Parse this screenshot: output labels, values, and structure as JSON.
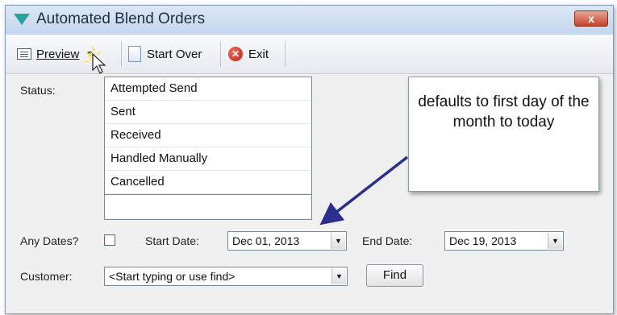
{
  "window": {
    "title": "Automated Blend Orders",
    "close_glyph": "x"
  },
  "toolbar": {
    "preview_label": "Preview",
    "start_over_label": "Start Over",
    "exit_label": "Exit",
    "icons": {
      "preview": "preview-icon",
      "start_over": "document-icon",
      "exit": "exit-icon"
    }
  },
  "form": {
    "status_label": "Status:",
    "status_options": [
      "Attempted Send",
      "Sent",
      "Received",
      "Handled Manually",
      "Cancelled"
    ],
    "any_dates_label": "Any Dates?",
    "any_dates_checked": false,
    "start_date_label": "Start Date:",
    "start_date_value": "Dec 01, 2013",
    "end_date_label": "End Date:",
    "end_date_value": "Dec 19, 2013",
    "customer_label": "Customer:",
    "customer_placeholder": "<Start typing or use find>",
    "find_label": "Find"
  },
  "callout": {
    "text": "defaults to first day of the month to today"
  },
  "colors": {
    "title_bar": "#c4d6ee",
    "callout_arrow": "#2a2f8f",
    "close_button": "#c5432c"
  }
}
